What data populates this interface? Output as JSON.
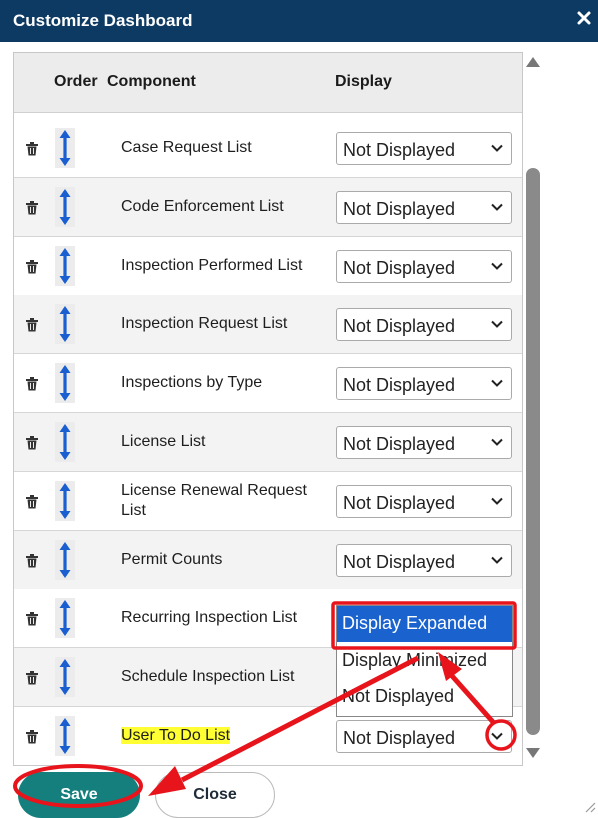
{
  "dialog": {
    "title": "Customize Dashboard"
  },
  "table": {
    "headers": {
      "order": "Order",
      "component": "Component",
      "display": "Display"
    },
    "rows": [
      {
        "component": "Case Request List",
        "display": "Not Displayed"
      },
      {
        "component": "Code Enforcement List",
        "display": "Not Displayed"
      },
      {
        "component": "Inspection Performed List",
        "display": "Not Displayed"
      },
      {
        "component": "Inspection Request List",
        "display": "Not Displayed"
      },
      {
        "component": "Inspections by Type",
        "display": "Not Displayed"
      },
      {
        "component": "License List",
        "display": "Not Displayed"
      },
      {
        "component": "License Renewal Request List",
        "display": "Not Displayed"
      },
      {
        "component": "Permit Counts",
        "display": "Not Displayed"
      },
      {
        "component": "Recurring Inspection List",
        "display": ""
      },
      {
        "component": "Schedule Inspection List",
        "display": ""
      },
      {
        "component": "User To Do List",
        "display": "Not Displayed"
      }
    ]
  },
  "display_options": [
    "Display Expanded",
    "Display Minimized",
    "Not Displayed"
  ],
  "buttons": {
    "save": "Save",
    "close": "Close"
  },
  "colors": {
    "header_bg": "#0d3a63",
    "save_bg": "#147f7d",
    "selected_option": "#1a63cf",
    "annotation": "#e8141b",
    "highlight": "#ffff33"
  },
  "icons": {
    "row_delete": "trash-icon",
    "row_order": "vertical-double-arrow-icon",
    "dialog_close": "close-icon",
    "select_toggle": "chevron-down-icon"
  }
}
